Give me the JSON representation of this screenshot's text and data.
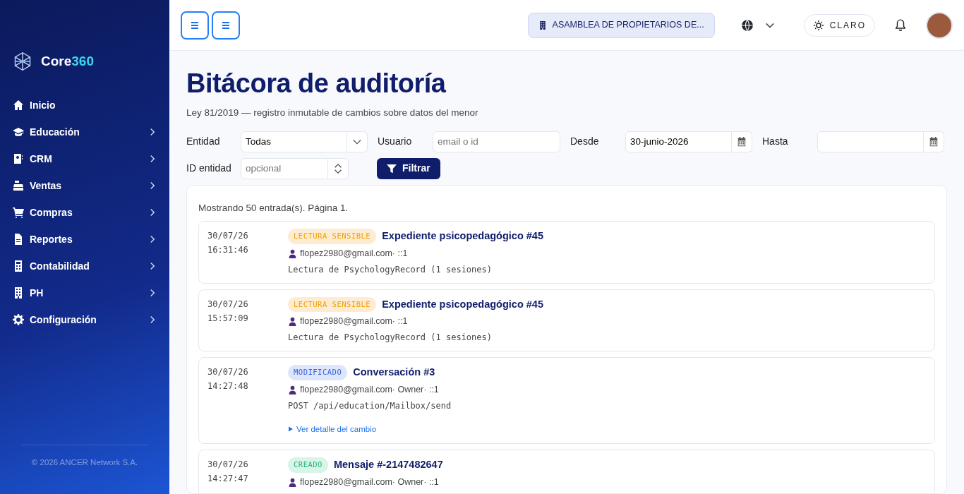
{
  "sidebar": {
    "brand": {
      "name": "Core",
      "accent": "360"
    },
    "items": [
      {
        "label": "Inicio",
        "expandable": false
      },
      {
        "label": "Educación",
        "expandable": true
      },
      {
        "label": "CRM",
        "expandable": true
      },
      {
        "label": "Ventas",
        "expandable": true
      },
      {
        "label": "Compras",
        "expandable": true
      },
      {
        "label": "Reportes",
        "expandable": true
      },
      {
        "label": "Contabilidad",
        "expandable": true
      },
      {
        "label": "PH",
        "expandable": true
      },
      {
        "label": "Configuración",
        "expandable": true
      }
    ],
    "footer": "© 2026 ANCER Network S.A."
  },
  "topbar": {
    "organization": "ASAMBLEA DE PROPIETARIOS DE...",
    "theme": "CLARO"
  },
  "page": {
    "title": "Bitácora de auditoría",
    "subtitle": "Ley 81/2019 — registro inmutable de cambios sobre datos del menor"
  },
  "filters": {
    "entity": {
      "label": "Entidad",
      "value": "Todas"
    },
    "user": {
      "label": "Usuario",
      "placeholder": "email o id"
    },
    "from": {
      "label": "Desde",
      "value": "30-junio-2026"
    },
    "to": {
      "label": "Hasta"
    },
    "entity_id": {
      "label": "ID entidad",
      "placeholder": "opcional"
    },
    "button": "Filtrar"
  },
  "results": {
    "summary": "Mostrando 50 entrada(s). Página 1.",
    "entries": [
      {
        "date": "30/07/26",
        "time": "16:31:46",
        "kind": "sensitive",
        "badge": "LECTURA SENSIBLE",
        "title": "Expediente psicopedagógico #45",
        "user": "flopez2980@gmail.com· ::1",
        "detail": "Lectura de PsychologyRecord (1 sesiones)"
      },
      {
        "date": "30/07/26",
        "time": "15:57:09",
        "kind": "sensitive",
        "badge": "LECTURA SENSIBLE",
        "title": "Expediente psicopedagógico #45",
        "user": "flopez2980@gmail.com· ::1",
        "detail": "Lectura de PsychologyRecord (1 sesiones)"
      },
      {
        "date": "30/07/26",
        "time": "14:27:48",
        "kind": "modified",
        "badge": "MODIFICADO",
        "title": "Conversación #3",
        "user": "flopez2980@gmail.com· Owner· ::1",
        "detail": "POST /api/education/Mailbox/send",
        "link": "Ver detalle del cambio"
      },
      {
        "date": "30/07/26",
        "time": "14:27:47",
        "kind": "created",
        "badge": "CREADO",
        "title": "Mensaje #-2147482647",
        "user": "flopez2980@gmail.com· Owner· ::1"
      }
    ]
  }
}
